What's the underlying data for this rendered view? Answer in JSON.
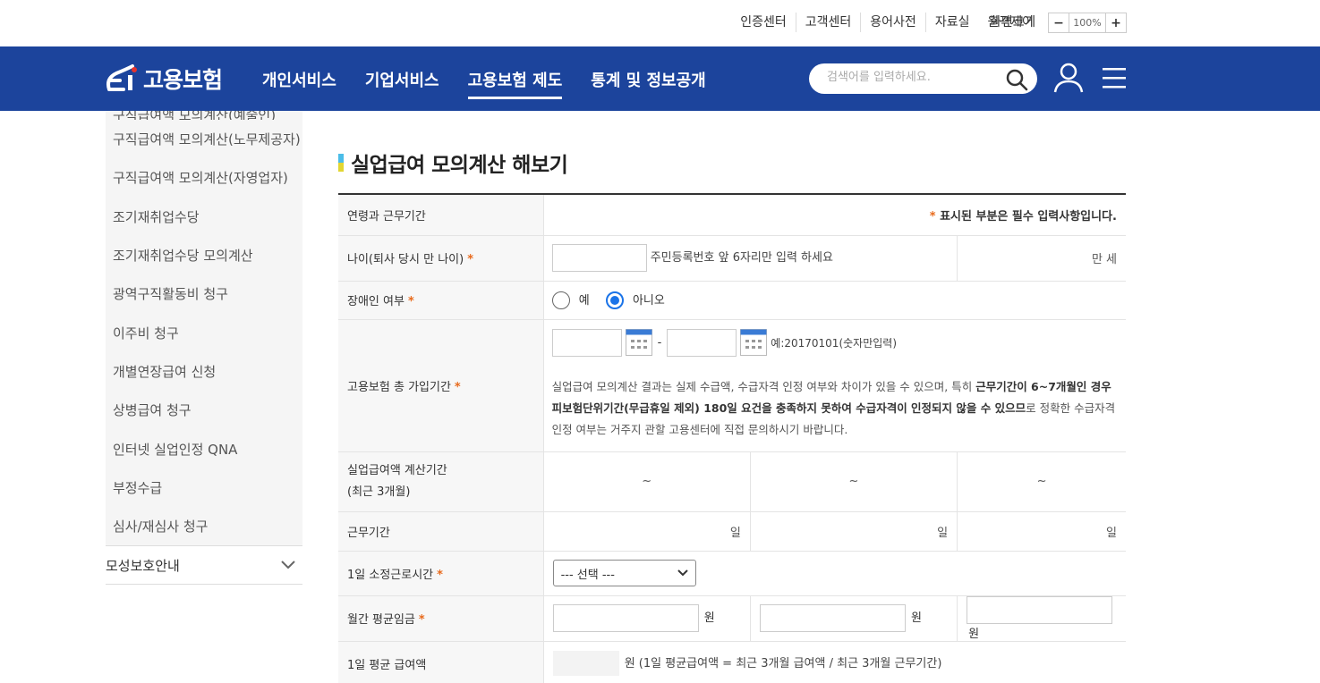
{
  "utility": {
    "links": [
      "인증센터",
      "고객센터",
      "용어사전",
      "자료실",
      "원격제어"
    ],
    "zoom_label": "화면크기",
    "zoom_minus": "−",
    "zoom_value": "100%",
    "zoom_plus": "+"
  },
  "header": {
    "logo_text": "고용보험",
    "menu": [
      "개인서비스",
      "기업서비스",
      "고용보험 제도",
      "통계 및 정보공개"
    ],
    "active_menu": "고용보험 제도",
    "search_placeholder": "검색어를 입력하세요.",
    "brand_color": "#1c449c"
  },
  "sidebar": {
    "items": [
      "구직급여액 모의계산(예술인)",
      "구직급여액 모의계산(노무제공자)",
      "구직급여액 모의계산(자영업자)",
      "조기재취업수당",
      "조기재취업수당 모의계산",
      "광역구직활동비 청구",
      "이주비 청구",
      "개별연장급여 신청",
      "상병급여 청구",
      "인터넷 실업인정 QNA",
      "부정수급",
      "심사/재심사 청구"
    ],
    "main_item": "모성보호안내"
  },
  "page": {
    "title": "실업급여 모의계산 해보기"
  },
  "form": {
    "header_label": "연령과 근무기간",
    "required_note_star": "*",
    "required_note": "표시된 부분은 필수 입력사항입니다.",
    "age_label": "나이(퇴사 당시 만 나이)",
    "age_hint": "주민등록번호 앞 6자리만 입력 하세요",
    "age_unit": "만 세",
    "disabled_label": "장애인 여부",
    "disabled_yes": "예",
    "disabled_no": "아니오",
    "period_label": "고용보험 총 가입기간",
    "period_sep": "-",
    "period_example": "예:20170101(숫자만입력)",
    "period_notice_1": "실업급여 모의계산 결과는 실제 수급액, 수급자격 인정 여부와 차이가 있을 수 있으며, 특히 ",
    "period_notice_bold_1": "근무기간이 6~7개월인 경우 피보험단위기간(무급휴일 제외) 180일 요건을 충족하지 못하여 수급자격이 인정되지 않을 수 있으므",
    "period_notice_2": "로 정확한 수급자격 인정 여부는 거주지 관할 고용센터에 직접 문의하시기 바랍니다.",
    "calc_period_label_1": "실업급여액 계산기간",
    "calc_period_label_2": "(최근 3개월)",
    "tilde": "~",
    "work_days_label": "근무기간",
    "day_unit": "일",
    "hours_label": "1일 소정근로시간",
    "hours_select": "--- 선택 ---",
    "wage_label": "월간 평균임금",
    "won_unit": "원",
    "daily_label": "1일 평균 급여액",
    "daily_formula": "원 (1일 평균급여액 = 최근 3개월 급여액 / 최근 3개월 근무기간)",
    "accent_color": "#e86a1c",
    "radio_color": "#1a73e8"
  }
}
